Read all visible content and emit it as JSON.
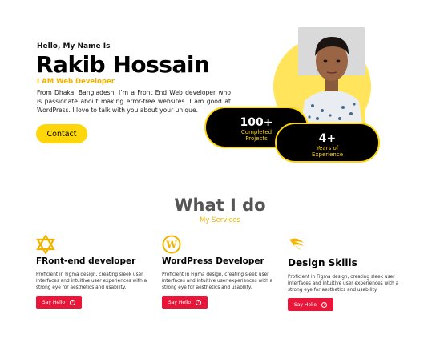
{
  "hero": {
    "greeting": "Hello, My Name Is",
    "name": "Rakib Hossain",
    "role": "I AM Web Developer",
    "bio": "From Dhaka, Bangladesh. I’m a Front End Web developer who is passionate about making error-free websites. I am good at WordPress. I love to talk with you about your unique.",
    "contact_label": "Contact",
    "stats": [
      {
        "number": "100+",
        "label_line1": "Completed",
        "label_line2": "Projects"
      },
      {
        "number": "4+",
        "label_line1": "Years of",
        "label_line2": "Experience"
      }
    ]
  },
  "services_section": {
    "title": "What I do",
    "subtitle": "My Services",
    "items": [
      {
        "icon": "star-of-david-icon",
        "title": "FRont-end developer",
        "description": "Proficient in Figma design, creating sleek user interfaces and intuitive user experiences with a strong eye for aesthetics and usability.",
        "button_label": "Say Hello"
      },
      {
        "icon": "wordpress-icon",
        "title": "WordPress Developer",
        "description": "Proficient in Figma design, creating sleek user interfaces and intuitive user experiences with a strong eye for aesthetics and usability.",
        "button_label": "Say Hello"
      },
      {
        "icon": "design-swoosh-icon",
        "title": "Design Skills",
        "description": "Proficient in Figma design, creating sleek user interfaces and intuitive user experiences with a strong eye for aesthetics and usability.",
        "button_label": "Say Hello"
      }
    ]
  },
  "colors": {
    "accent_yellow": "#ffd60a",
    "button_red": "#e8173a",
    "dark": "#000000"
  }
}
